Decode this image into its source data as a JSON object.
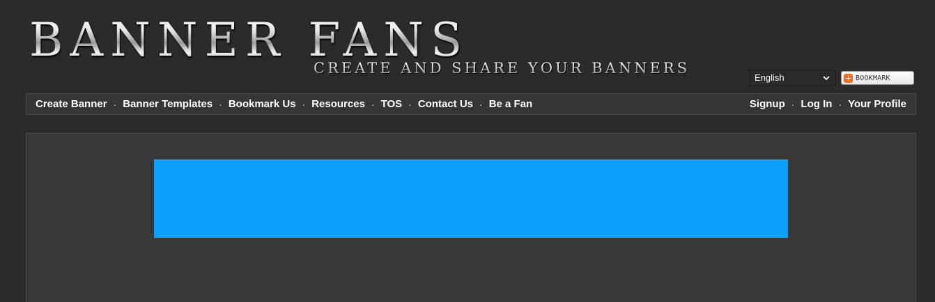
{
  "logo": {
    "title": "BANNER FANS",
    "tagline": "CREATE AND SHARE YOUR BANNERS"
  },
  "language": {
    "selected": "English"
  },
  "bookmark": {
    "label": "BOOKMARK",
    "icon": "plus-icon",
    "icon_color": "#f16b23"
  },
  "nav": {
    "left": [
      {
        "label": "Create Banner"
      },
      {
        "label": "Banner Templates"
      },
      {
        "label": "Bookmark Us"
      },
      {
        "label": "Resources"
      },
      {
        "label": "TOS"
      },
      {
        "label": "Contact Us"
      },
      {
        "label": "Be a Fan"
      }
    ],
    "right": [
      {
        "label": "Signup"
      },
      {
        "label": "Log In"
      },
      {
        "label": "Your Profile"
      }
    ],
    "separator": "·"
  },
  "colors": {
    "page_background": "#2b2b2b",
    "panel_background": "#373737",
    "ad_banner": "#0aa0fb"
  }
}
